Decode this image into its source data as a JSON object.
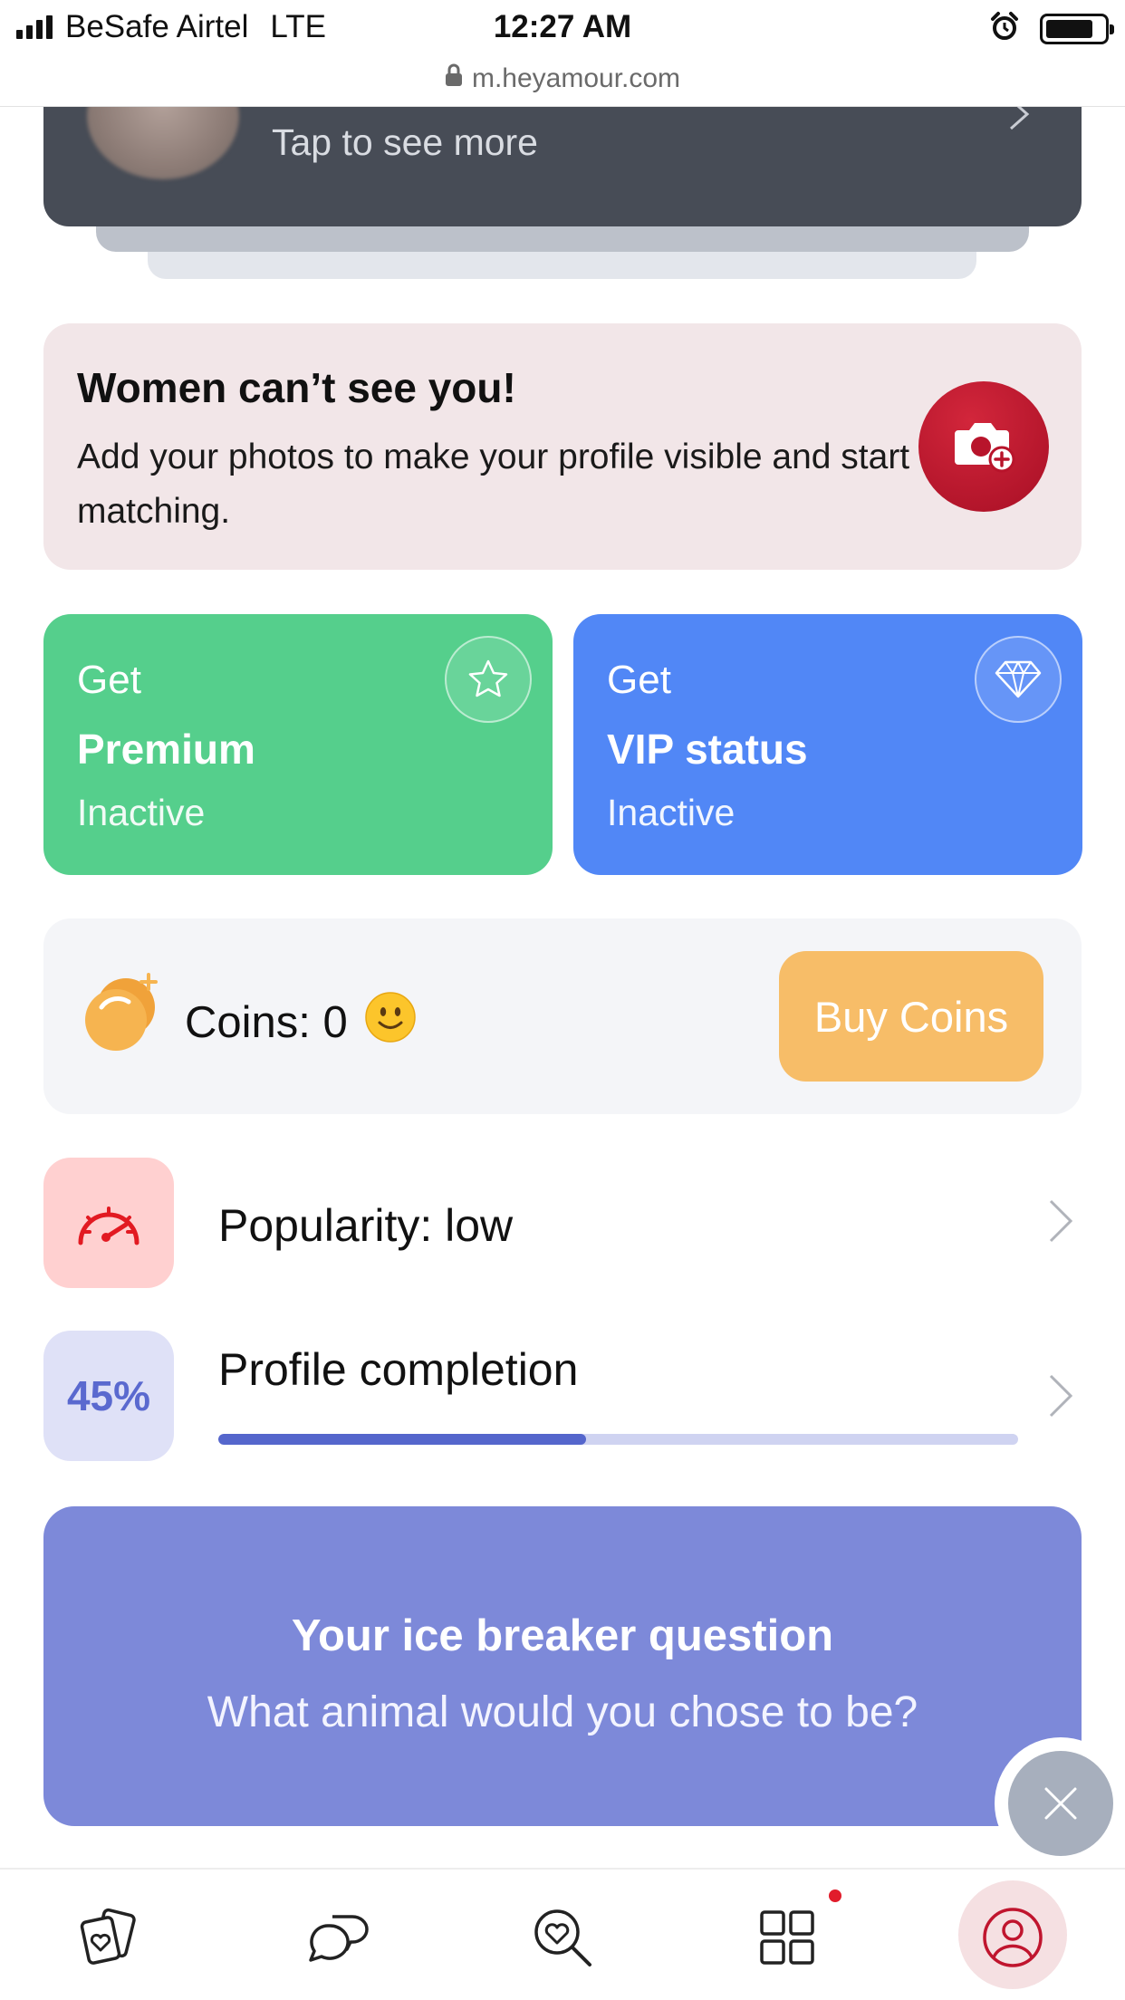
{
  "status_bar": {
    "carrier": "BeSafe Airtel",
    "network": "LTE",
    "time": "12:27 AM",
    "url": "m.heyamour.com"
  },
  "profile_card": {
    "subtitle": "Tap to see more"
  },
  "warning": {
    "title": "Women can’t see you!",
    "text": "Add your photos to make your profile visible and start matching."
  },
  "premium": {
    "prefix": "Get",
    "name": "Premium",
    "status": "Inactive",
    "icon": "star-icon",
    "color": "#55cf8c"
  },
  "vip": {
    "prefix": "Get",
    "name": "VIP status",
    "status": "Inactive",
    "icon": "diamond-icon",
    "color": "#5187f6"
  },
  "coins": {
    "label": "Coins: 0",
    "emoji": "🙂",
    "buy_label": "Buy Coins",
    "buy_color": "#f7bd68"
  },
  "popularity": {
    "label": "Popularity: low",
    "icon": "speedometer-icon"
  },
  "completion": {
    "label": "Profile completion",
    "percent_text": "45%",
    "progress": 0.46
  },
  "ice_breaker": {
    "title": "Your ice breaker question",
    "question": "What animal would you chose to be?"
  },
  "bottom_nav": {
    "items": [
      {
        "name": "cards",
        "icon": "cards-heart-icon"
      },
      {
        "name": "chats",
        "icon": "chat-bubbles-icon"
      },
      {
        "name": "search",
        "icon": "search-heart-icon"
      },
      {
        "name": "apps",
        "icon": "grid-icon",
        "notification": true
      },
      {
        "name": "profile",
        "icon": "user-icon",
        "active": true
      }
    ]
  },
  "colors": {
    "accent_red": "#c0152e",
    "ice_card": "#7d89d9",
    "dark_card": "#474c56"
  }
}
